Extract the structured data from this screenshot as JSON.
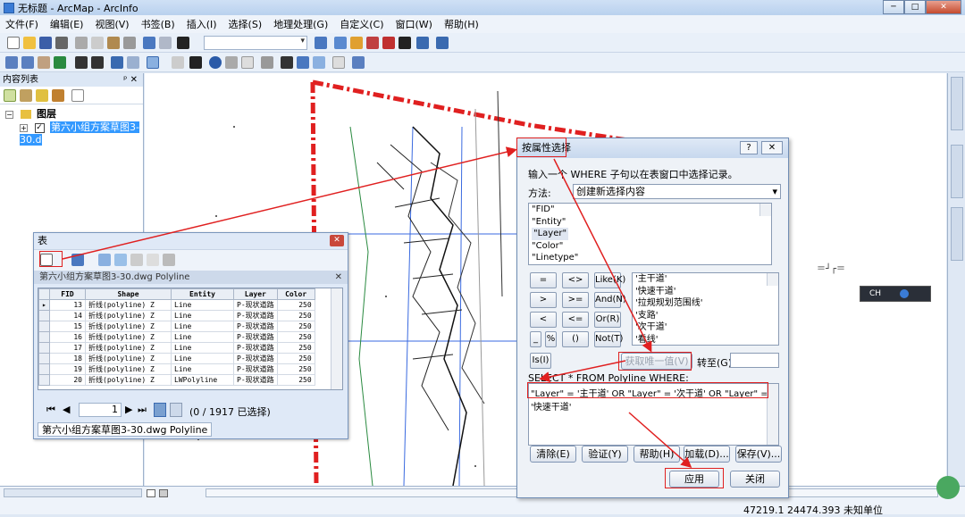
{
  "app": {
    "title": "无标题 - ArcMap - ArcInfo"
  },
  "menu": [
    "文件(F)",
    "编辑(E)",
    "视图(V)",
    "书签(B)",
    "插入(I)",
    "选择(S)",
    "地理处理(G)",
    "自定义(C)",
    "窗口(W)",
    "帮助(H)"
  ],
  "toc": {
    "header": "内容列表",
    "pin": "ᵖ ✕",
    "layers_group": "图层",
    "layer_name": "第六小组方案草图3-30.d"
  },
  "table_window": {
    "title": "表",
    "tab_title": "第六小组方案草图3-30.dwg Polyline",
    "columns": [
      "FID",
      "Shape",
      "Entity",
      "Layer",
      "Color"
    ],
    "rows": [
      [
        "13",
        "折线(polyline) Z",
        "Line",
        "P-现状道路",
        "250"
      ],
      [
        "14",
        "折线(polyline) Z",
        "Line",
        "P-现状道路",
        "250"
      ],
      [
        "15",
        "折线(polyline) Z",
        "Line",
        "P-现状道路",
        "250"
      ],
      [
        "16",
        "折线(polyline) Z",
        "Line",
        "P-现状道路",
        "250"
      ],
      [
        "17",
        "折线(polyline) Z",
        "Line",
        "P-现状道路",
        "250"
      ],
      [
        "18",
        "折线(polyline) Z",
        "Line",
        "P-现状道路",
        "250"
      ],
      [
        "19",
        "折线(polyline) Z",
        "Line",
        "P-现状道路",
        "250"
      ],
      [
        "20",
        "折线(polyline) Z",
        "LWPolyline",
        "P-现状道路",
        "250"
      ]
    ],
    "current_record": "1",
    "selection_status": "(0 / 1917 已选择)",
    "bottom_tab": "第六小组方案草图3-30.dwg Polyline"
  },
  "dialog": {
    "title": "按属性选择",
    "help_btn": "?",
    "instruction": "输入一个 WHERE 子句以在表窗口中选择记录。",
    "method_label": "方法:",
    "method_value": "创建新选择内容",
    "fields": [
      "\"FID\"",
      "\"Entity\"",
      "\"Layer\"",
      "\"Color\"",
      "\"Linetype\""
    ],
    "operators": [
      "=",
      "<>",
      "Like(K)",
      ">",
      ">=",
      "And(N)",
      "<",
      "<=",
      "Or(R)",
      "_",
      "%",
      "()",
      "Not(T)",
      "Is(I)"
    ],
    "values": [
      "'主干道'",
      "'快速干道'",
      "'拉规规划范围线'",
      "'支路'",
      "'次干道'",
      "'看线'"
    ],
    "unique_btn": "获取唯一值(V)",
    "goto_label": "转至(G):",
    "sql_prefix": "SELECT * FROM Polyline WHERE:",
    "sql_expression": "\"Layer\" = '主干道' OR \"Layer\" = '次干道' OR \"Layer\" = '快速干道'",
    "buttons": [
      "清除(E)",
      "验证(Y)",
      "帮助(H)",
      "加载(D)...",
      "保存(V)..."
    ],
    "apply": "应用",
    "close": "关闭"
  },
  "status": {
    "coords": "47219.1  24474.393 未知单位"
  },
  "floating_widget": {
    "label": "CH"
  }
}
